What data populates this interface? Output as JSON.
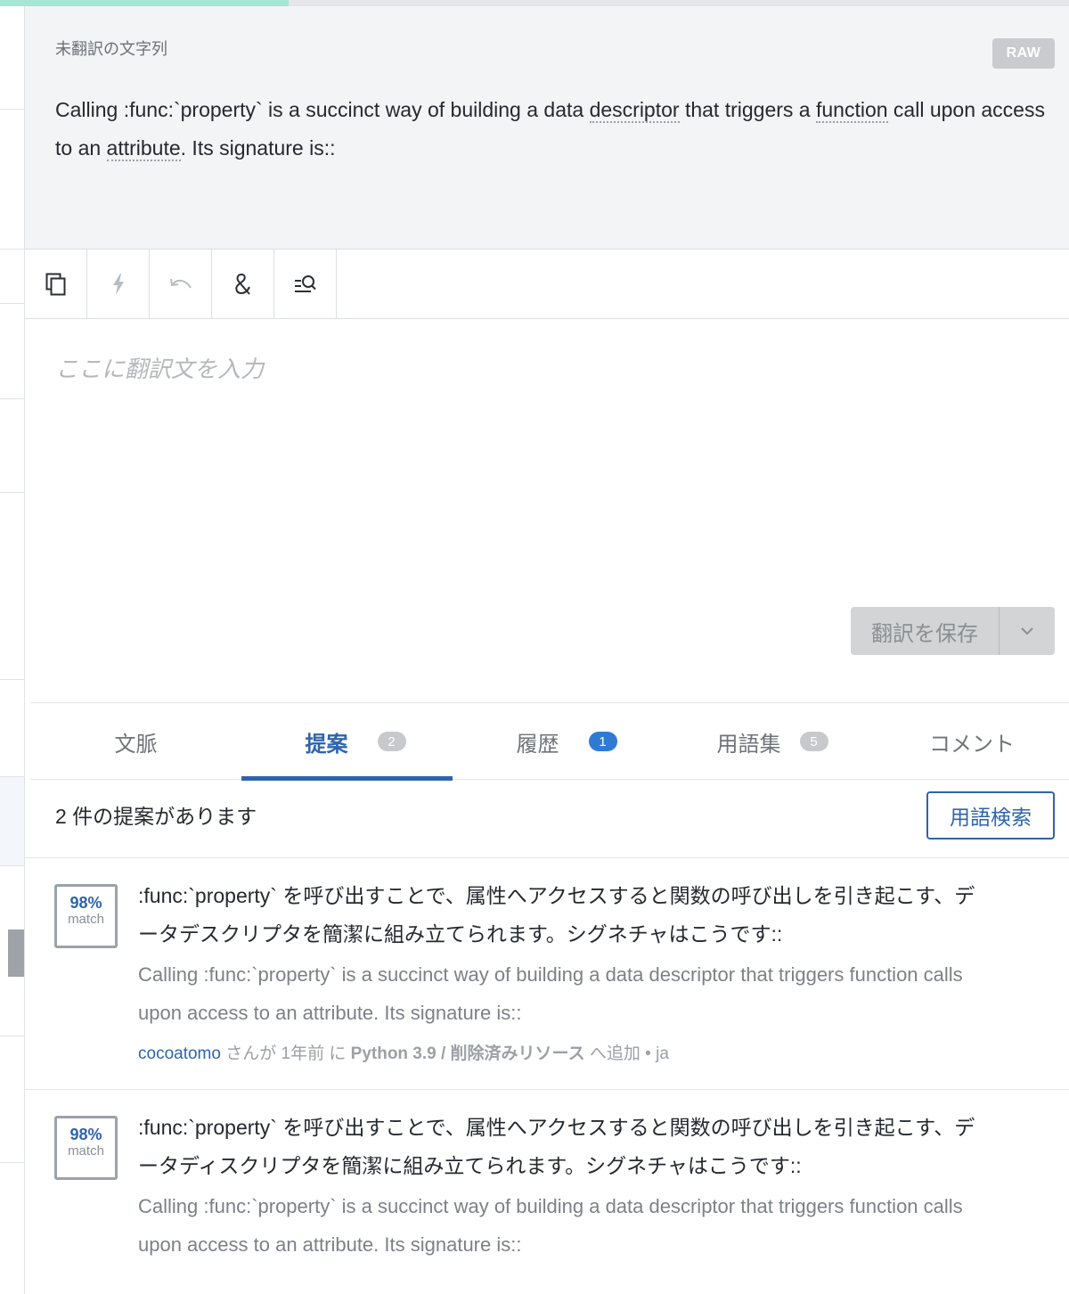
{
  "progress": {
    "fraction": 0.27
  },
  "source": {
    "label": "未翻訳の文字列",
    "raw_button": "RAW",
    "text": {
      "p1": "Calling :func:`property` is a succinct way of building a data ",
      "g1": "descriptor",
      "p2": " that triggers a ",
      "g2": "function",
      "p3": " call upon access to an ",
      "g3": "attribute",
      "p4": ".  Its signature is::"
    }
  },
  "toolbar": {
    "icons": [
      "copy-icon",
      "lightning-icon",
      "undo-icon",
      "ampersand-icon",
      "search-list-icon"
    ]
  },
  "editor": {
    "placeholder": "ここに翻訳文を入力",
    "save_label": "翻訳を保存"
  },
  "tabs": {
    "context": {
      "label": "文脈"
    },
    "suggestions": {
      "label": "提案",
      "count": "2"
    },
    "history": {
      "label": "履歴",
      "count": "1"
    },
    "glossary": {
      "label": "用語集",
      "count": "5"
    },
    "comments": {
      "label": "コメント"
    }
  },
  "suggestions": {
    "title": "2 件の提案があります",
    "term_search_label": "用語検索",
    "items": [
      {
        "match_pct": "98%",
        "match_label": "match",
        "target": ":func:`property` を呼び出すことで、属性へアクセスすると関数の呼び出しを引き起こす、データデスクリプタを簡潔に組み立てられます。シグネチャはこうです::",
        "source": "Calling :func:`property` is a succinct way of building a data descriptor that triggers function calls upon access to an attribute.  Its signature is::",
        "user": "cocoatomo",
        "added_by": " さんが 1年前 に ",
        "project": "Python 3.9 / 削除済みリソース",
        "added_suffix": " へ追加 • ja"
      },
      {
        "match_pct": "98%",
        "match_label": "match",
        "target": ":func:`property` を呼び出すことで、属性へアクセスすると関数の呼び出しを引き起こす、データディスクリプタを簡潔に組み立てられます。シグネチャはこうです::",
        "source": "Calling :func:`property` is a succinct way of building a data descriptor that triggers function calls upon access to an attribute.  Its signature is::"
      }
    ]
  },
  "colors": {
    "accent": "#2f64ad",
    "badge_blue": "#2f7bd4",
    "progress": "#a6e6d4"
  }
}
